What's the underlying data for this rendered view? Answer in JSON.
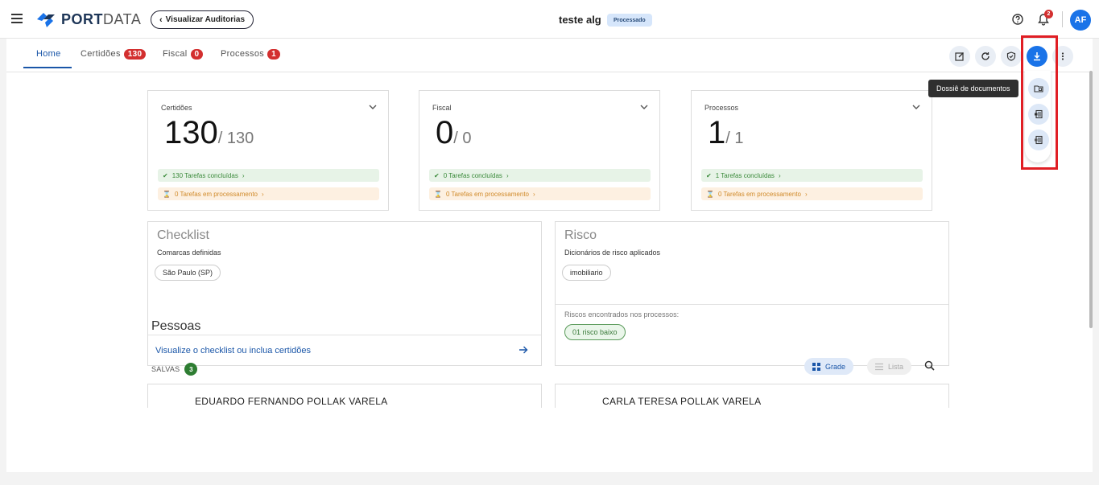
{
  "header": {
    "logo_bold": "PORT",
    "logo_light": "DATA",
    "back_label": "Visualizar Auditorias",
    "doc_title": "teste alg",
    "status_label": "Processado",
    "notifications_count": "2",
    "avatar_initials": "AF"
  },
  "tabs": [
    {
      "label": "Home",
      "count": ""
    },
    {
      "label": "Certidões",
      "count": "130"
    },
    {
      "label": "Fiscal",
      "count": "0"
    },
    {
      "label": "Processos",
      "count": "1"
    }
  ],
  "toolbar": {
    "icons": [
      "edit-icon",
      "refresh-icon",
      "shield-check-icon",
      "download-icon",
      "more-vertical-icon"
    ]
  },
  "dossier_menu": {
    "tooltip": "Dossiê de documentos",
    "items": [
      "folder-id-icon",
      "file-export-icon",
      "file-excel-icon"
    ]
  },
  "stats": [
    {
      "title": "Certidões",
      "value": "130",
      "total": "/ 130",
      "done": "130 Tarefas concluídas",
      "processing": "0 Tarefas em processamento"
    },
    {
      "title": "Fiscal",
      "value": "0",
      "total": "/ 0",
      "done": "0 Tarefas concluídas",
      "processing": "0 Tarefas em processamento"
    },
    {
      "title": "Processos",
      "value": "1",
      "total": "/ 1",
      "done": "1 Tarefas concluídas",
      "processing": "0 Tarefas em processamento"
    }
  ],
  "checklist": {
    "title": "Checklist",
    "subtitle": "Comarcas definidas",
    "chip": "São Paulo (SP)",
    "footer_link": "Visualize o checklist ou inclua certidões"
  },
  "risk": {
    "title": "Risco",
    "subtitle": "Dicionários de risco aplicados",
    "chip": "imobiliario",
    "found_label": "Riscos encontrados nos processos:",
    "found_chip": "01 risco baixo"
  },
  "people": {
    "title": "Pessoas",
    "saved_label": "SALVAS",
    "saved_count": "3",
    "grid_label": "Grade",
    "list_label": "Lista",
    "cards": [
      "EDUARDO FERNANDO POLLAK VARELA",
      "CARLA TERESA POLLAK VARELA"
    ]
  },
  "colors": {
    "accent": "#1a73e8",
    "badge_red": "#d32f2f",
    "success": "#2e7d32",
    "highlight": "#e01e24"
  }
}
